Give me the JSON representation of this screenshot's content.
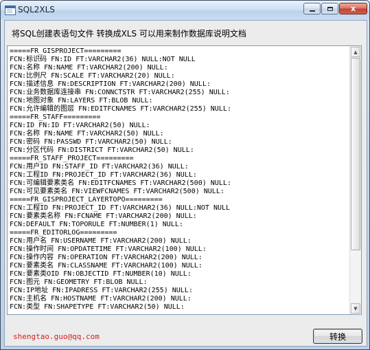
{
  "window": {
    "title": "SQL2XLS",
    "controls": {
      "minimize": "",
      "maximize": "",
      "close": "x"
    }
  },
  "header": {
    "description": "将SQL创建表语句文件  转换成XLS  可以用来制作数据库说明文档"
  },
  "output": {
    "lines": [
      "=====FR_GISPROJECT=========",
      "FCN:标识码 FN:ID FT:VARCHAR2(36) NULL:NOT NULL",
      "FCN:名称 FN:NAME FT:VARCHAR2(200) NULL:",
      "FCN:比例尺 FN:SCALE FT:VARCHAR2(20) NULL:",
      "FCN:描述信息 FN:DESCRIPTION FT:VARCHAR2(200) NULL:",
      "FCN:业务数据库连接串 FN:CONNCTSTR FT:VARCHAR2(255) NULL:",
      "FCN:地图对象 FN:LAYERS FT:BLOB NULL:",
      "FCN:允许编辑的图层 FN:EDITFCNAMES FT:VARCHAR2(255) NULL:",
      "=====FR_STAFF=========",
      "FCN:ID FN:ID FT:VARCHAR2(50) NULL:",
      "FCN:名称 FN:NAME FT:VARCHAR2(50) NULL:",
      "FCN:密码 FN:PASSWD FT:VARCHAR2(50) NULL:",
      "FCN:分区代码 FN:DISTRICT FT:VARCHAR2(50) NULL:",
      "=====FR_STAFF_PROJECT=========",
      "FCN:用户ID FN:STAFF_ID FT:VARCHAR2(36) NULL:",
      "FCN:工程ID FN:PROJECT_ID FT:VARCHAR2(36) NULL:",
      "FCN:可编辑要素类名 FN:EDITFCNAMES FT:VARCHAR2(500) NULL:",
      "FCN:可见要素类名 FN:VIEWFCNAMES FT:VARCHAR2(500) NULL:",
      "=====FR_GISPROJECT_LAYERTOPO=========",
      "FCN:工程ID FN:PROJECT_ID FT:VARCHAR2(36) NULL:NOT NULL",
      "FCN:要素类名称 FN:FCNAME FT:VARCHAR2(200) NULL:",
      "FCN:DEFAULT FN:TOPORULE FT:NUMBER(1) NULL:",
      "=====FR_EDITORLOG=========",
      "FCN:用户名 FN:USERNAME FT:VARCHAR2(200) NULL:",
      "FCN:操作时间 FN:OPDATETIME FT:VARCHAR2(100) NULL:",
      "FCN:操作内容 FN:OPERATION FT:VARCHAR2(200) NULL:",
      "FCN:要素类名 FN:CLASSNAME FT:VARCHAR2(100) NULL:",
      "FCN:要素类OID FN:OBJECTID FT:NUMBER(10) NULL:",
      "FCN:图元 FN:GEOMETRY FT:BLOB NULL:",
      "FCN:IP地址 FN:IPADRESS FT:VARCHAR2(255) NULL:",
      "FCN:主机名 FN:HOSTNAME FT:VARCHAR2(200) NULL:",
      "FCN:类型 FN:SHAPETYPE FT:VARCHAR2(50) NULL:"
    ]
  },
  "footer": {
    "email": "shengtao.guo@qq.com",
    "convert_button": "转换"
  },
  "icons": {
    "app": "window-app-icon",
    "scroll_up": "scroll-up-arrow-icon",
    "scroll_down": "scroll-down-arrow-icon"
  },
  "colors": {
    "email_text": "#d81e1e",
    "titlebar": "#cfe0f3",
    "close_button": "#c4422f"
  }
}
